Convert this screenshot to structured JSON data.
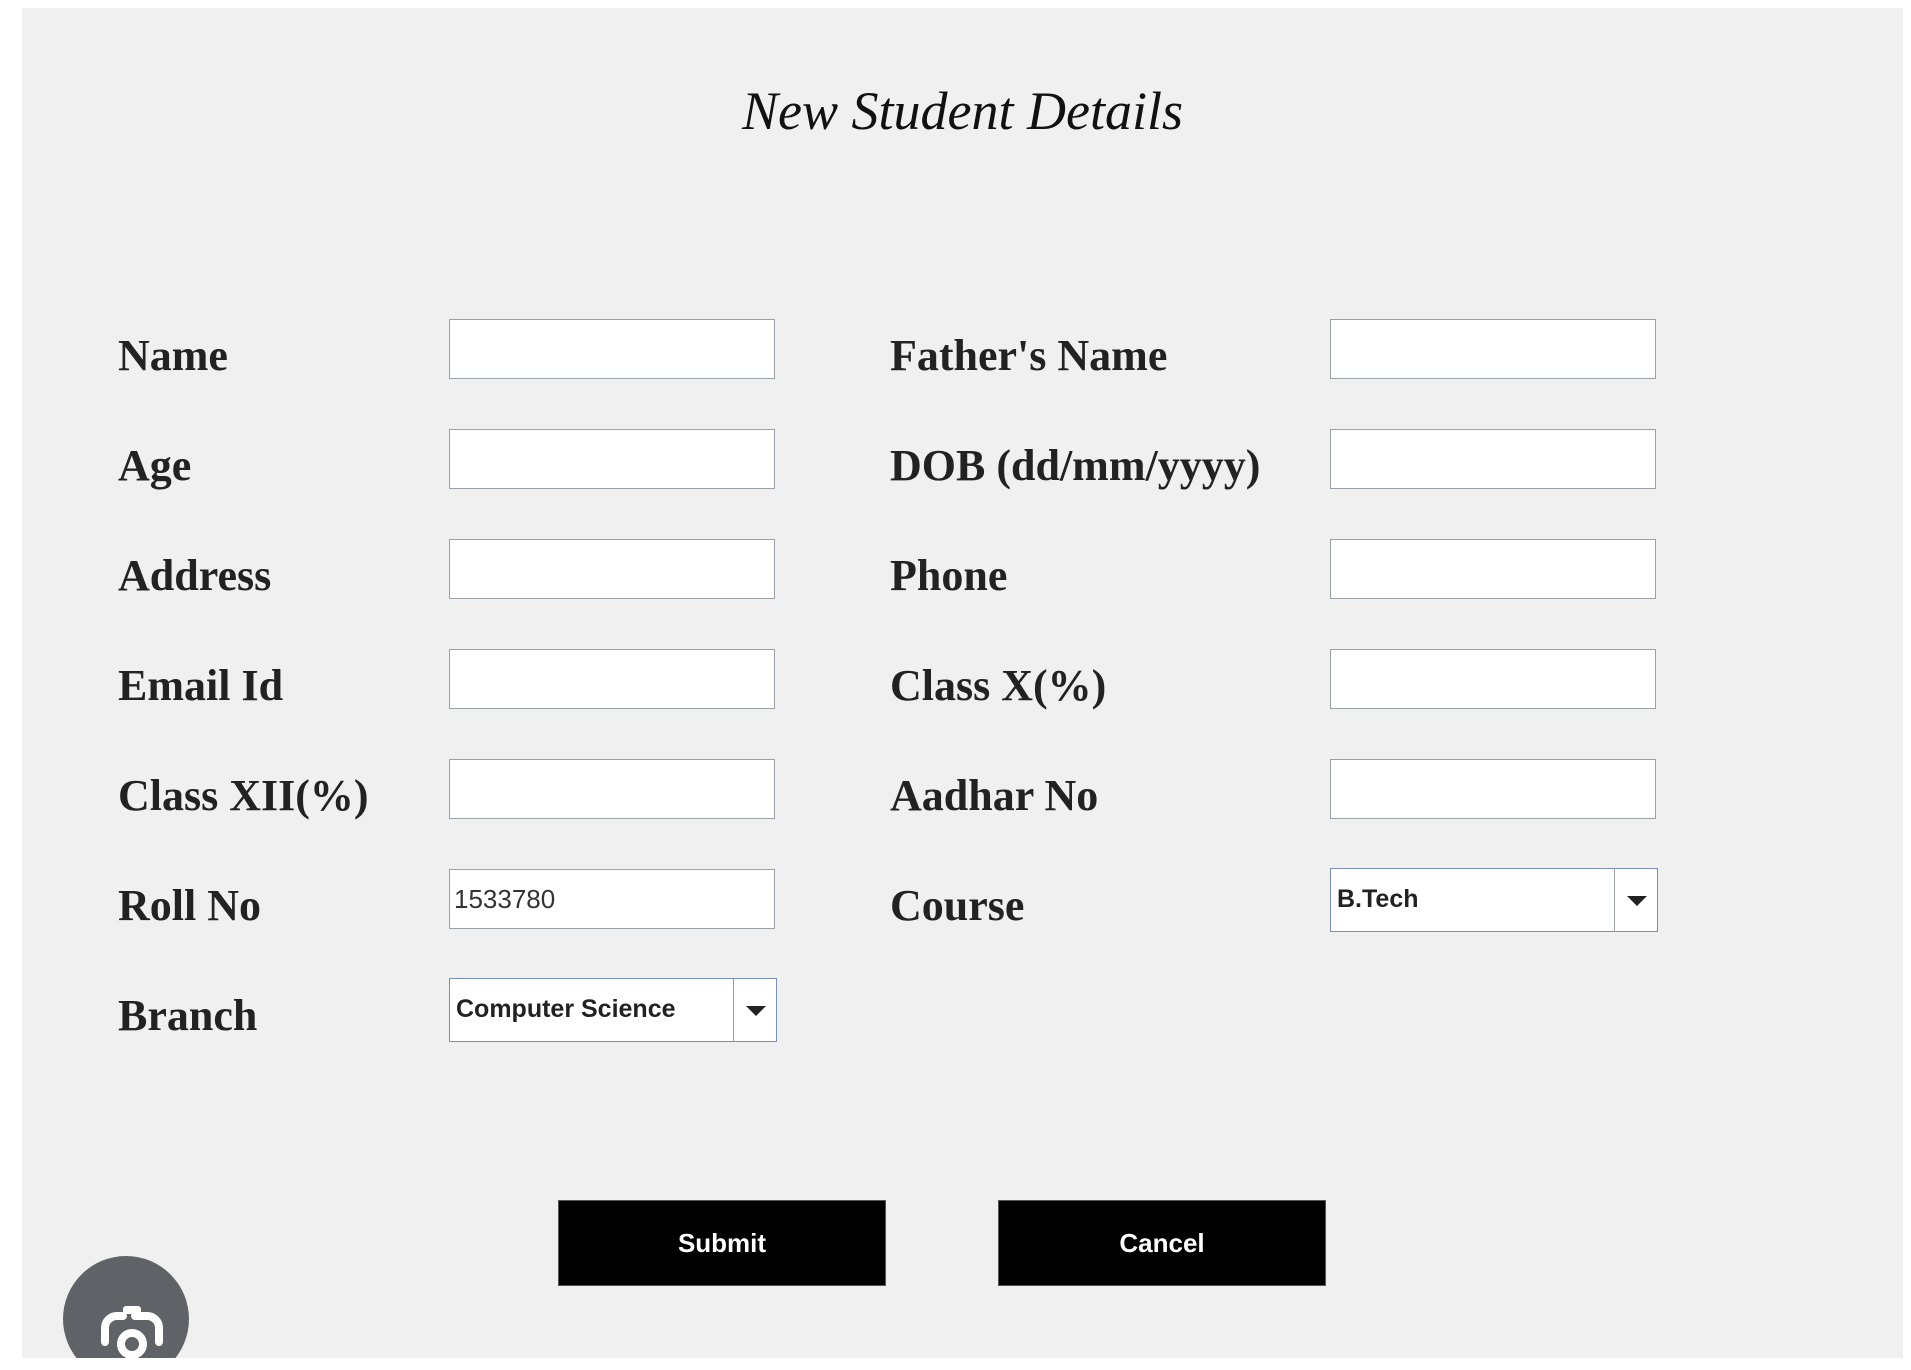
{
  "form": {
    "title": "New Student Details",
    "fields": {
      "name": {
        "label": "Name",
        "value": ""
      },
      "fathers_name": {
        "label": "Father's Name",
        "value": ""
      },
      "age": {
        "label": "Age",
        "value": ""
      },
      "dob": {
        "label": "DOB (dd/mm/yyyy)",
        "value": ""
      },
      "address": {
        "label": "Address",
        "value": ""
      },
      "phone": {
        "label": "Phone",
        "value": ""
      },
      "email": {
        "label": "Email Id",
        "value": ""
      },
      "class_x": {
        "label": "Class X(%)",
        "value": ""
      },
      "class_xii": {
        "label": "Class XII(%)",
        "value": ""
      },
      "aadhar": {
        "label": "Aadhar No",
        "value": ""
      },
      "roll_no": {
        "label": "Roll No",
        "value": "1533780"
      },
      "course": {
        "label": "Course",
        "selected": "B.Tech"
      },
      "branch": {
        "label": "Branch",
        "selected": "Computer Science"
      }
    },
    "buttons": {
      "submit": "Submit",
      "cancel": "Cancel"
    }
  },
  "icons": {
    "dropdown_arrow": "chevron-down-icon",
    "lens": "google-lens-icon"
  },
  "colors": {
    "panel_background": "#f0f0f0",
    "button_background": "#000000",
    "button_text": "#ffffff",
    "lens_badge": "#5f6368"
  }
}
